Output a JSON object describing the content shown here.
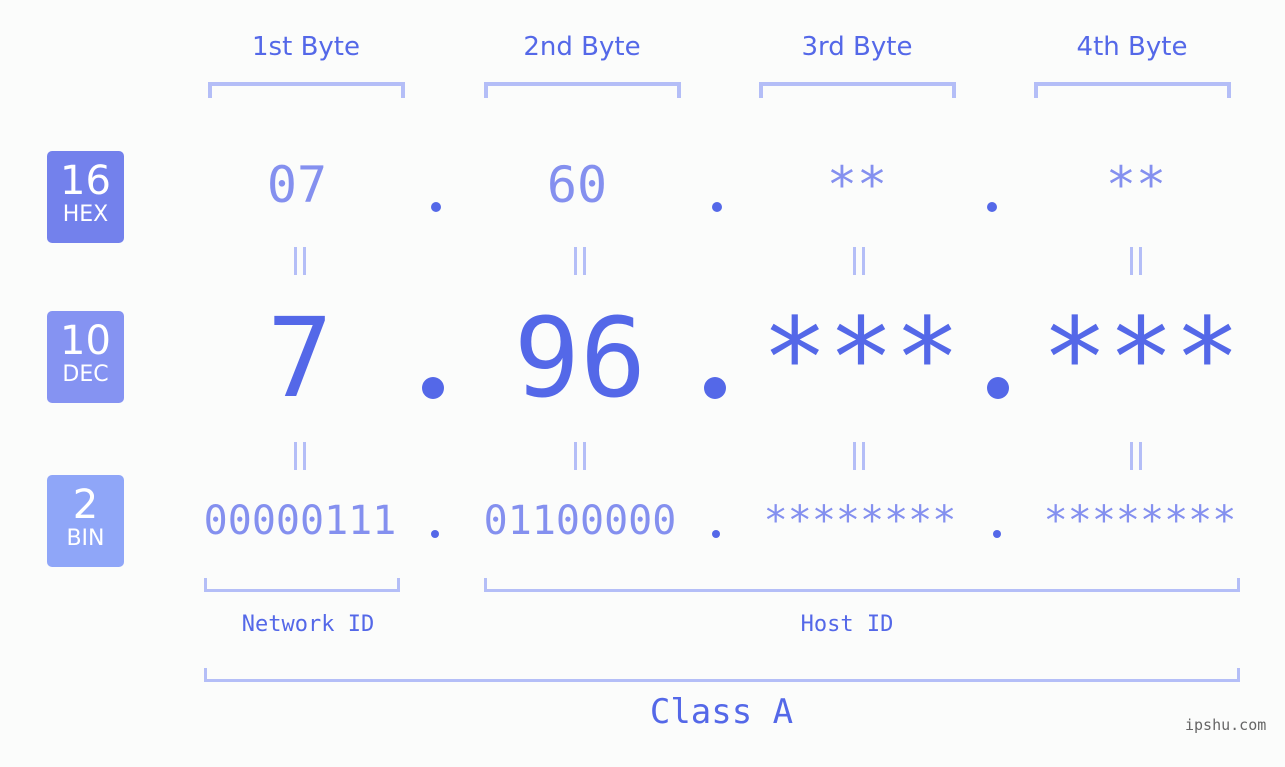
{
  "byte_headers": [
    "1st Byte",
    "2nd Byte",
    "3rd Byte",
    "4th Byte"
  ],
  "badges": {
    "hex": {
      "number": "16",
      "label": "HEX",
      "color": "#7381ec"
    },
    "dec": {
      "number": "10",
      "label": "DEC",
      "color": "#8593f2"
    },
    "bin": {
      "number": "2",
      "label": "BIN",
      "color": "#8fa6f8"
    }
  },
  "hex_values": [
    "07",
    "60",
    "**",
    "**"
  ],
  "dec_values": [
    "7",
    "96",
    "***",
    "***"
  ],
  "bin_values": [
    "00000111",
    "01100000",
    "********",
    "********"
  ],
  "separator": ".",
  "network_id_label": "Network ID",
  "host_id_label": "Host ID",
  "class_label": "Class A",
  "watermark": "ipshu.com",
  "colors": {
    "accent": "#5468e8",
    "light_accent": "#8490ef",
    "bracket": "#b4bef7",
    "background": "#fbfcfb"
  }
}
